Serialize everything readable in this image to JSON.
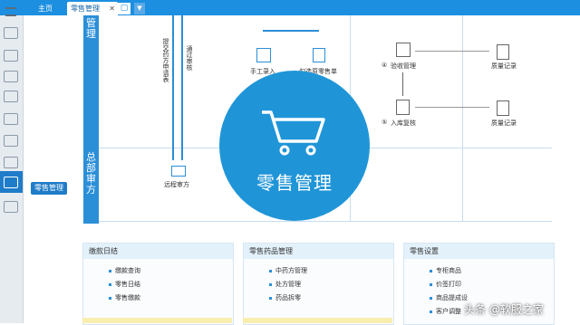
{
  "tabs": {
    "home": "主页",
    "active": "零售管理",
    "close": "✕"
  },
  "sidebar": {
    "tooltip": "零售管理",
    "items": [
      "menu",
      "coins",
      "chain",
      "money",
      "shop",
      "cash",
      "gift",
      "truck",
      "cart",
      "monitor"
    ]
  },
  "bands": {
    "top": "管理",
    "bottom": "总部审方"
  },
  "flow": {
    "v1": "提交药方申请表",
    "v2": "通过审核",
    "manual": "手工录入",
    "select": "勾选原零售单",
    "check": "验收管理",
    "warehouse": "入库复核",
    "quality1": "质量记录",
    "quality2": "质量记录",
    "remote": "远程审方",
    "step4": "④",
    "step5": "⑤"
  },
  "center_title": "零售管理",
  "panels": [
    {
      "title": "缴款日结",
      "items": [
        "缴款查询",
        "零售日结",
        "零售缴款"
      ]
    },
    {
      "title": "零售药品管理",
      "items": [
        "中药方管理",
        "处方管理",
        "药品拆零"
      ]
    },
    {
      "title": "零售设置",
      "items": [
        "专柜商品",
        "价签打印",
        "商品提成设",
        "客户调整"
      ]
    }
  ],
  "watermark": "头条 @软服之家"
}
